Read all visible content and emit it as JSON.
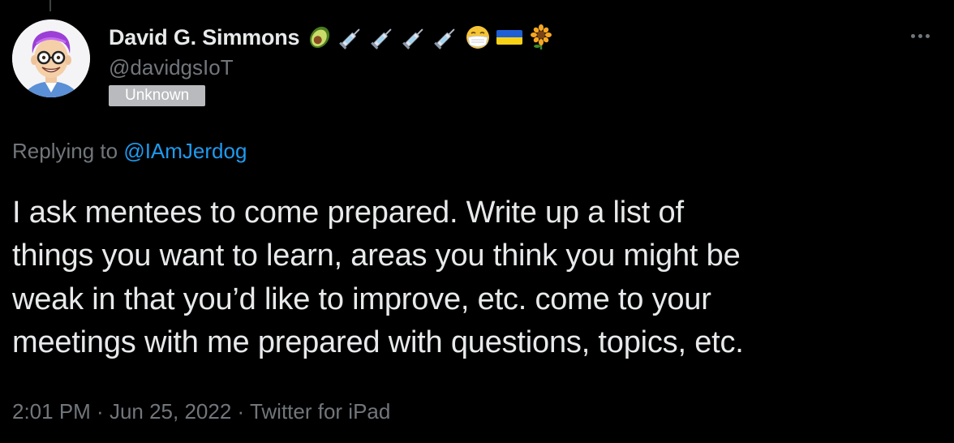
{
  "author": {
    "display_name": "David G. Simmons",
    "handle": "@davidgsIoT",
    "badge": "Unknown",
    "name_emojis": [
      "avocado-emoji",
      "syringe-emoji",
      "syringe-emoji",
      "syringe-emoji",
      "syringe-emoji",
      "face-with-mask-emoji",
      "ukraine-flag-emoji",
      "sunflower-emoji"
    ]
  },
  "reply": {
    "prefix": "Replying to ",
    "mention": "@IAmJerdog"
  },
  "tweet": {
    "lines": [
      "I ask mentees to come prepared. Write up a list of",
      "things you want to learn, areas you think you might be",
      "weak in that you’d like to improve, etc.  come to your",
      "meetings with me prepared with questions, topics, etc."
    ]
  },
  "meta": {
    "time": "2:01 PM",
    "sep1": " · ",
    "date": "Jun 25, 2022",
    "sep2": " · ",
    "source": "Twitter for iPad"
  },
  "colors": {
    "background": "#000000",
    "primary_text": "#e7e9ea",
    "secondary_text": "#71767b",
    "link": "#1d9bf0",
    "badge_bg": "#b9babd"
  },
  "icons": {
    "more": "more-horizontal-icon"
  }
}
